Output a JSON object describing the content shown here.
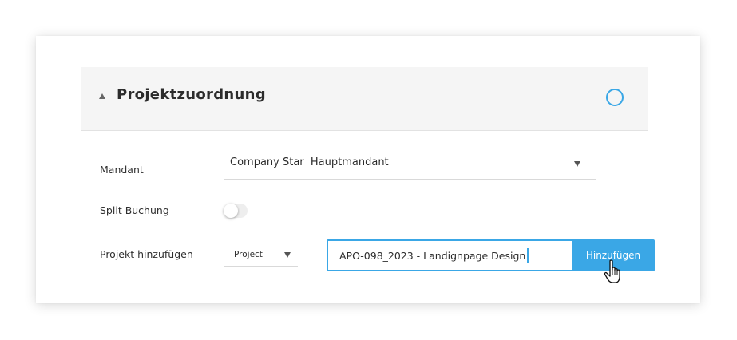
{
  "section": {
    "title": "Projektzuordnung",
    "collapse_icon": "triangle-up-icon",
    "status_icon": "circle-icon",
    "accent_color": "#3aa7e6"
  },
  "form": {
    "mandant": {
      "label": "Mandant",
      "value": "Company Star  Hauptmandant"
    },
    "split": {
      "label": "Split Buchung",
      "enabled": false
    },
    "project": {
      "label": "Projekt hinzufügen",
      "type_value": "Project",
      "input_value": "APO-098_2023 - Landignpage Design",
      "button_label": "Hinzufügen"
    }
  },
  "cursor_icon": "hand-pointer-icon"
}
